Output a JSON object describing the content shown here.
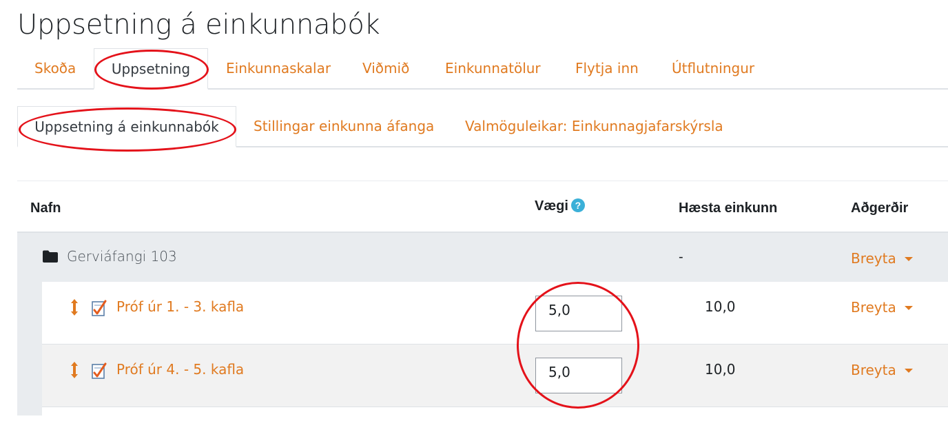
{
  "page": {
    "title": "Uppsetning á einkunnabók"
  },
  "primary_tabs": [
    {
      "label": "Skoða"
    },
    {
      "label": "Uppsetning"
    },
    {
      "label": "Einkunnaskalar"
    },
    {
      "label": "Viðmið"
    },
    {
      "label": "Einkunnatölur"
    },
    {
      "label": "Flytja inn"
    },
    {
      "label": "Útflutningur"
    }
  ],
  "secondary_tabs": [
    {
      "label": "Uppsetning á einkunnabók"
    },
    {
      "label": "Stillingar einkunna áfanga"
    },
    {
      "label": "Valmöguleikar: Einkunnagjafarskýrsla"
    }
  ],
  "active": {
    "primary": "Uppsetning",
    "secondary": "Uppsetning á einkunnabók"
  },
  "table": {
    "headers": {
      "name": "Nafn",
      "weight": "Vægi",
      "max_grade": "Hæsta einkunn",
      "actions": "Aðgerðir"
    },
    "help_icon_glyph": "?",
    "category": {
      "name": "Gerviáfangi 103",
      "max_grade": "-",
      "action": "Breyta"
    },
    "items": [
      {
        "name": "Próf úr 1. - 3. kafla",
        "weight": "5,0",
        "max_grade": "10,0",
        "action": "Breyta"
      },
      {
        "name": "Próf úr 4. - 5. kafla",
        "weight": "5,0",
        "max_grade": "10,0",
        "action": "Breyta"
      }
    ]
  },
  "colors": {
    "link": "#e07a20",
    "highlight_ellipse": "#e4121a",
    "help_icon": "#3bb0d8",
    "category_bg": "#e9ecef"
  },
  "icons": [
    "folder-icon",
    "move-icon",
    "quiz-icon",
    "help-icon",
    "caret-down-icon"
  ]
}
